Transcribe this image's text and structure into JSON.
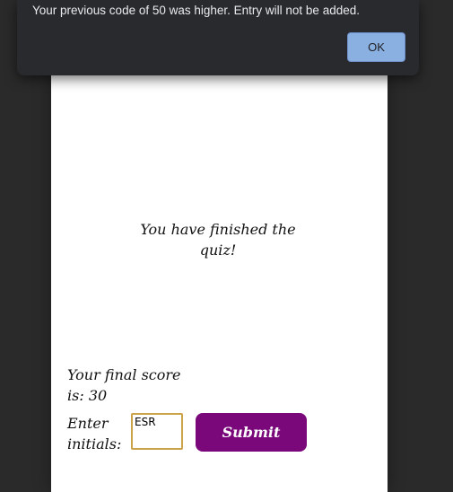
{
  "dialog": {
    "message": "Your previous code of 50 was higher. Entry will not be added.",
    "ok_label": "OK"
  },
  "quiz": {
    "finished_text": "You have finished the quiz!",
    "score_label": "Your final score is:",
    "score_value": "30",
    "initials_label": "Enter initials:",
    "initials_value": "ESR",
    "submit_label": "Submit"
  },
  "colors": {
    "background": "#2a2a2a",
    "card": "#ffffff",
    "dialog": "#292a2d",
    "ok_button": "#8ab0e2",
    "submit_button": "#7a087a",
    "input_border": "#c9a24a"
  }
}
